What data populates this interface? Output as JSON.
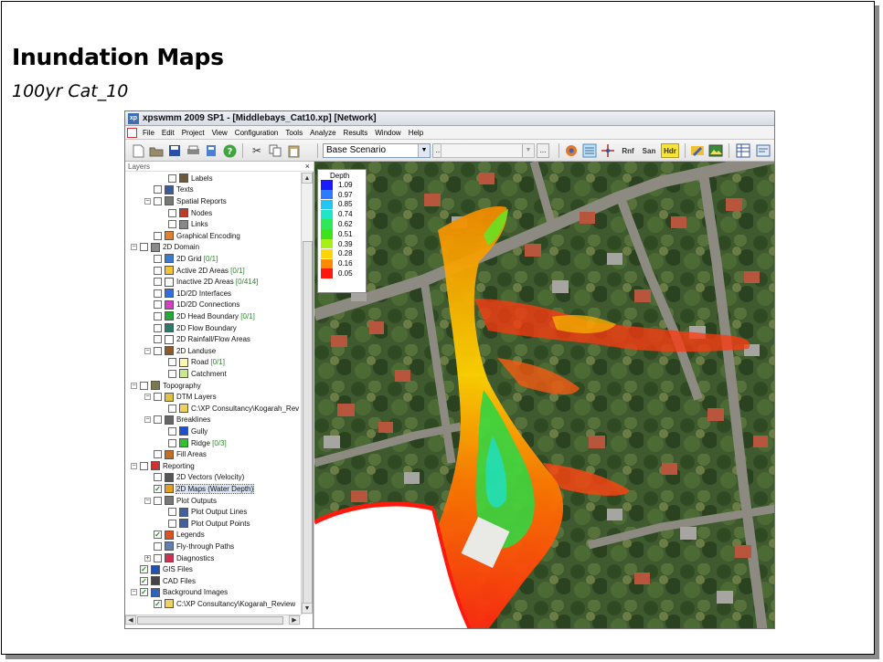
{
  "slide": {
    "title": "Inundation Maps",
    "subtitle": "100yr Cat_10"
  },
  "window": {
    "title": "xpswmm 2009 SP1 - [Middlebays_Cat10.xp] [Network]"
  },
  "menu": [
    "File",
    "Edit",
    "Project",
    "View",
    "Configuration",
    "Tools",
    "Analyze",
    "Results",
    "Window",
    "Help"
  ],
  "toolbar": {
    "scenario": "Base Scenario",
    "dots": "...",
    "rnf_label": "Rnf",
    "san_label": "San",
    "hdr_label": "Hdr"
  },
  "layers": {
    "header": "Layers",
    "close": "×",
    "items": [
      {
        "label": "Labels",
        "count": "",
        "indent": 2,
        "exp": "",
        "checked": false,
        "icon": "#6b5a3a"
      },
      {
        "label": "Texts",
        "count": "",
        "indent": 1,
        "exp": "",
        "checked": false,
        "icon": "#3a5a9a"
      },
      {
        "label": "Spatial Reports",
        "count": "",
        "indent": 1,
        "exp": "−",
        "checked": false,
        "icon": "#777777"
      },
      {
        "label": "Nodes",
        "count": "",
        "indent": 2,
        "exp": "",
        "checked": false,
        "icon": "#c0392b"
      },
      {
        "label": "Links",
        "count": "",
        "indent": 2,
        "exp": "",
        "checked": false,
        "icon": "#888888"
      },
      {
        "label": "Graphical Encoding",
        "count": "",
        "indent": 1,
        "exp": "",
        "checked": false,
        "icon": "#e08030"
      },
      {
        "label": "2D Domain",
        "count": "",
        "indent": 0,
        "exp": "−",
        "checked": false,
        "icon": "#8a8a8a"
      },
      {
        "label": "2D Grid",
        "count": " [0/1]",
        "indent": 1,
        "exp": "",
        "checked": false,
        "icon": "#3a7ad0"
      },
      {
        "label": "Active 2D Areas",
        "count": " [0/1]",
        "indent": 1,
        "exp": "",
        "checked": false,
        "icon": "#f2c230"
      },
      {
        "label": "Inactive 2D Areas",
        "count": " [0/414]",
        "indent": 1,
        "exp": "",
        "checked": false,
        "icon": "#ffffff"
      },
      {
        "label": "1D/2D Interfaces",
        "count": "",
        "indent": 1,
        "exp": "",
        "checked": false,
        "icon": "#2f6fe0"
      },
      {
        "label": "1D/2D Connections",
        "count": "",
        "indent": 1,
        "exp": "",
        "checked": false,
        "icon": "#d040c0"
      },
      {
        "label": "2D Head Boundary",
        "count": " [0/1]",
        "indent": 1,
        "exp": "",
        "checked": false,
        "icon": "#22aa33"
      },
      {
        "label": "2D Flow Boundary",
        "count": "",
        "indent": 1,
        "exp": "",
        "checked": false,
        "icon": "#2a7a6a"
      },
      {
        "label": "2D Rainfall/Flow Areas",
        "count": "",
        "indent": 1,
        "exp": "",
        "checked": false,
        "icon": "#ffffff"
      },
      {
        "label": "2D Landuse",
        "count": "",
        "indent": 1,
        "exp": "−",
        "checked": false,
        "icon": "#8a5a2a"
      },
      {
        "label": "Road",
        "count": " [0/1]",
        "indent": 2,
        "exp": "",
        "checked": false,
        "icon": "#fff6b0"
      },
      {
        "label": "Catchment",
        "count": "",
        "indent": 2,
        "exp": "",
        "checked": false,
        "icon": "#c8e890"
      },
      {
        "label": "Topography",
        "count": "",
        "indent": 0,
        "exp": "−",
        "checked": false,
        "icon": "#7a7a4a"
      },
      {
        "label": "DTM Layers",
        "count": "",
        "indent": 1,
        "exp": "−",
        "checked": false,
        "icon": "#e0c040"
      },
      {
        "label": "C:\\XP Consultancy\\Kogarah_Rev",
        "count": "",
        "indent": 2,
        "exp": "",
        "checked": false,
        "icon": "#f0d060"
      },
      {
        "label": "Breaklines",
        "count": "",
        "indent": 1,
        "exp": "−",
        "checked": false,
        "icon": "#666666"
      },
      {
        "label": "Gully",
        "count": "",
        "indent": 2,
        "exp": "",
        "checked": false,
        "icon": "#2050d0"
      },
      {
        "label": "Ridge",
        "count": " [0/3]",
        "indent": 2,
        "exp": "",
        "checked": false,
        "icon": "#30c030"
      },
      {
        "label": "Fill Areas",
        "count": "",
        "indent": 1,
        "exp": "",
        "checked": false,
        "icon": "#c07020"
      },
      {
        "label": "Reporting",
        "count": "",
        "indent": 0,
        "exp": "−",
        "checked": false,
        "icon": "#d03030"
      },
      {
        "label": "2D Vectors (Velocity)",
        "count": "",
        "indent": 1,
        "exp": "",
        "checked": false,
        "icon": "#555555"
      },
      {
        "label": "2D Maps (Water Depth)",
        "count": "",
        "indent": 1,
        "exp": "",
        "checked": true,
        "icon": "#e0a020",
        "selected": true
      },
      {
        "label": "Plot Outputs",
        "count": "",
        "indent": 1,
        "exp": "−",
        "checked": false,
        "icon": "#777777"
      },
      {
        "label": "Plot Output Lines",
        "count": "",
        "indent": 2,
        "exp": "",
        "checked": false,
        "icon": "#4060a0"
      },
      {
        "label": "Plot Output Points",
        "count": "",
        "indent": 2,
        "exp": "",
        "checked": false,
        "icon": "#4060a0"
      },
      {
        "label": "Legends",
        "count": "",
        "indent": 1,
        "exp": "",
        "checked": true,
        "icon": "#e05020"
      },
      {
        "label": "Fly-through Paths",
        "count": "",
        "indent": 1,
        "exp": "",
        "checked": false,
        "icon": "#6080b0"
      },
      {
        "label": "Diagnostics",
        "count": "",
        "indent": 1,
        "exp": "+",
        "checked": false,
        "icon": "#d03050"
      },
      {
        "label": "GIS Files",
        "count": "",
        "indent": 0,
        "exp": "",
        "checked": true,
        "icon": "#2050b0"
      },
      {
        "label": "CAD Files",
        "count": "",
        "indent": 0,
        "exp": "",
        "checked": true,
        "icon": "#444444"
      },
      {
        "label": "Background Images",
        "count": "",
        "indent": 0,
        "exp": "−",
        "checked": true,
        "icon": "#3060c0"
      },
      {
        "label": "C:\\XP Consultancy\\Kogarah_Review",
        "count": "",
        "indent": 1,
        "exp": "",
        "checked": true,
        "icon": "#f0d060"
      }
    ]
  },
  "legend": {
    "title": "Depth",
    "entries": [
      {
        "value": "1.09",
        "color": "#1a1aff"
      },
      {
        "value": "0.97",
        "color": "#2f7bff"
      },
      {
        "value": "0.85",
        "color": "#22c6f0"
      },
      {
        "value": "0.74",
        "color": "#1fe6c8"
      },
      {
        "value": "0.62",
        "color": "#2ee85a"
      },
      {
        "value": "0.51",
        "color": "#3ee21a"
      },
      {
        "value": "0.39",
        "color": "#a6f018"
      },
      {
        "value": "0.28",
        "color": "#ffd500"
      },
      {
        "value": "0.16",
        "color": "#ff8a00"
      },
      {
        "value": "0.05",
        "color": "#ff1a10"
      }
    ]
  }
}
